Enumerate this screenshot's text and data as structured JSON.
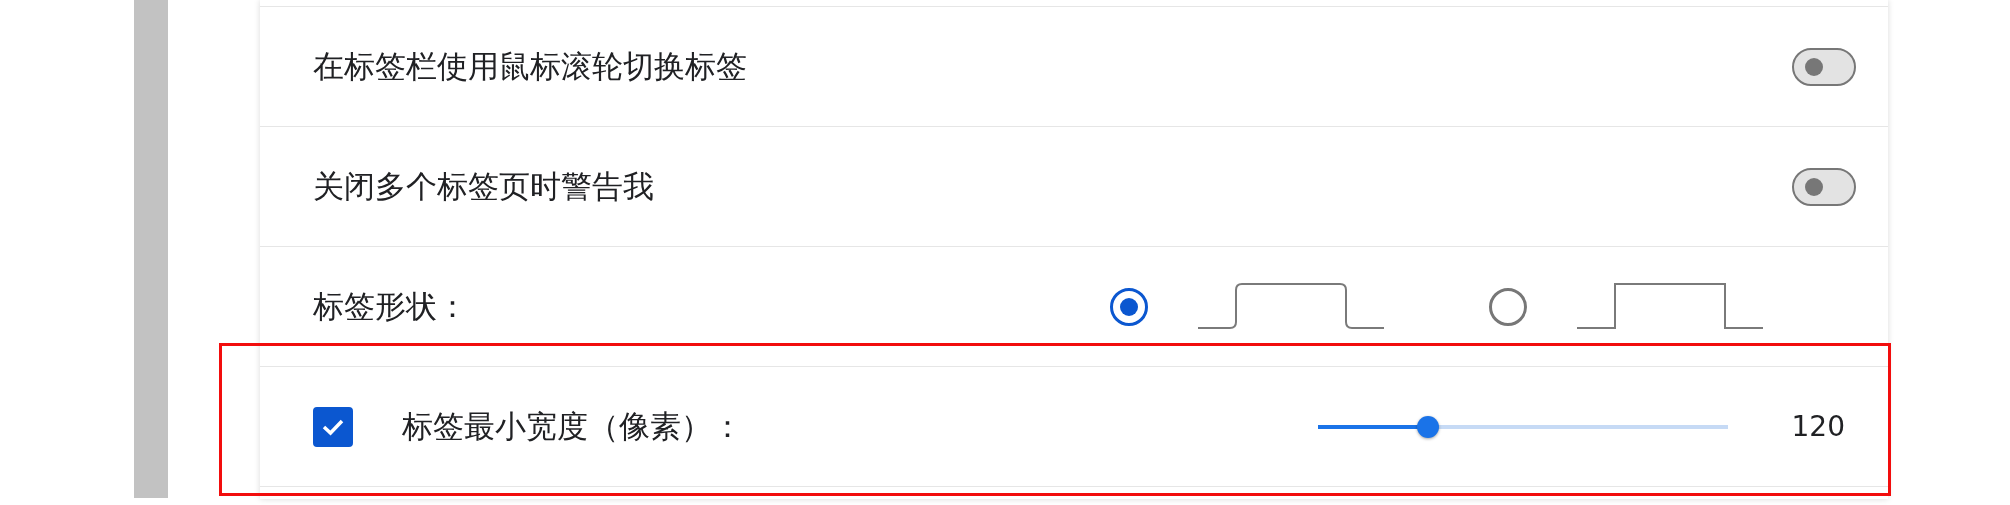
{
  "settings": [
    {
      "kind": "toggle",
      "label": "在标签栏使用鼠标滚轮切换标签",
      "on": false
    },
    {
      "kind": "toggle",
      "label": "关闭多个标签页时警告我",
      "on": false
    },
    {
      "kind": "radio",
      "label": "标签形状：",
      "options": [
        {
          "kind": "rounded",
          "selected": true
        },
        {
          "kind": "square",
          "selected": false
        }
      ]
    },
    {
      "kind": "slider",
      "label": "标签最小宽度（像素）：",
      "checked": true,
      "level": 0.27,
      "reading": "120",
      "highlighted": true
    }
  ]
}
